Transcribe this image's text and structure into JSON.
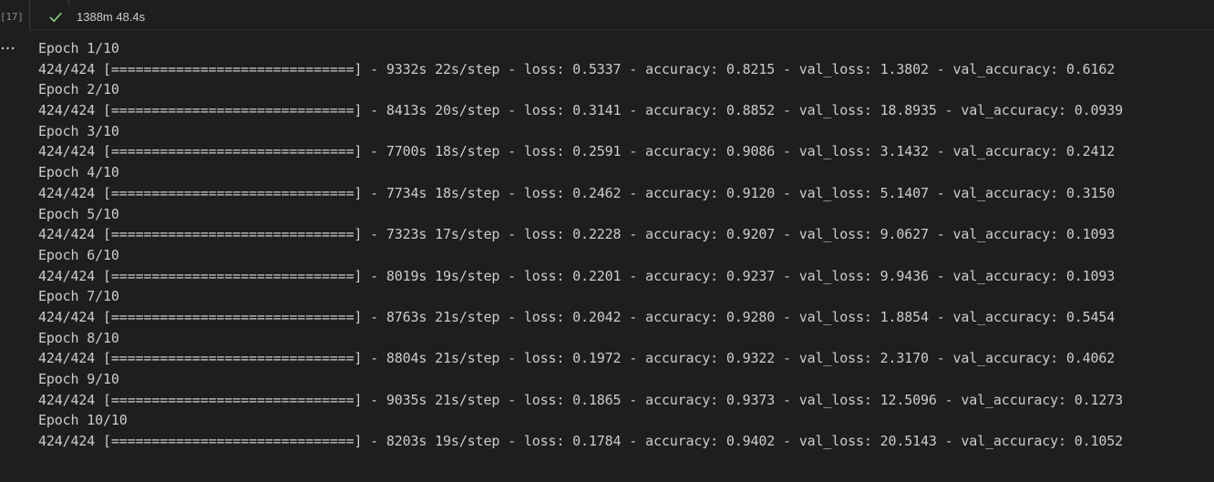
{
  "cell": {
    "execution_count": "[17]",
    "status_icon": "check-icon",
    "success_color": "#89d185",
    "duration": "1388m 48.4s",
    "output_menu_icon": "ellipsis-icon"
  },
  "output": {
    "lines": [
      "Epoch 1/10",
      "424/424 [==============================] - 9332s 22s/step - loss: 0.5337 - accuracy: 0.8215 - val_loss: 1.3802 - val_accuracy: 0.6162",
      "Epoch 2/10",
      "424/424 [==============================] - 8413s 20s/step - loss: 0.3141 - accuracy: 0.8852 - val_loss: 18.8935 - val_accuracy: 0.0939",
      "Epoch 3/10",
      "424/424 [==============================] - 7700s 18s/step - loss: 0.2591 - accuracy: 0.9086 - val_loss: 3.1432 - val_accuracy: 0.2412",
      "Epoch 4/10",
      "424/424 [==============================] - 7734s 18s/step - loss: 0.2462 - accuracy: 0.9120 - val_loss: 5.1407 - val_accuracy: 0.3150",
      "Epoch 5/10",
      "424/424 [==============================] - 7323s 17s/step - loss: 0.2228 - accuracy: 0.9207 - val_loss: 9.0627 - val_accuracy: 0.1093",
      "Epoch 6/10",
      "424/424 [==============================] - 8019s 19s/step - loss: 0.2201 - accuracy: 0.9237 - val_loss: 9.9436 - val_accuracy: 0.1093",
      "Epoch 7/10",
      "424/424 [==============================] - 8763s 21s/step - loss: 0.2042 - accuracy: 0.9280 - val_loss: 1.8854 - val_accuracy: 0.5454",
      "Epoch 8/10",
      "424/424 [==============================] - 8804s 21s/step - loss: 0.1972 - accuracy: 0.9322 - val_loss: 2.3170 - val_accuracy: 0.4062",
      "Epoch 9/10",
      "424/424 [==============================] - 9035s 21s/step - loss: 0.1865 - accuracy: 0.9373 - val_loss: 12.5096 - val_accuracy: 0.1273",
      "Epoch 10/10",
      "424/424 [==============================] - 8203s 19s/step - loss: 0.1784 - accuracy: 0.9402 - val_loss: 20.5143 - val_accuracy: 0.1052"
    ]
  }
}
